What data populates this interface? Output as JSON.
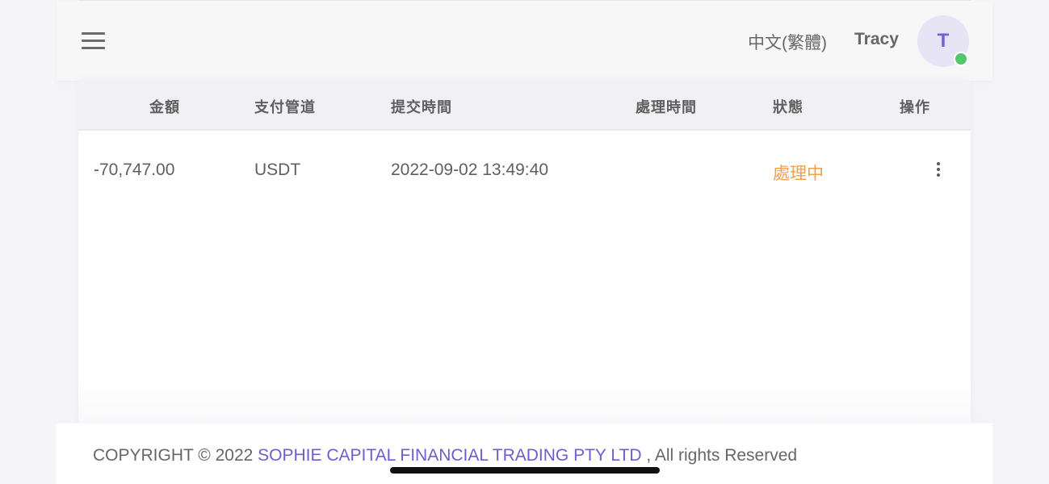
{
  "header": {
    "language": "中文(繁體)",
    "username": "Tracy",
    "avatar_initial": "T"
  },
  "table": {
    "columns": [
      "金額",
      "支付管道",
      "提交時間",
      "處理時間",
      "狀態",
      "操作"
    ],
    "rows": [
      {
        "amount": "-70,747.00",
        "channel": "USDT",
        "submitted": "2022-09-02 13:49:40",
        "processed": "",
        "status": "處理中"
      }
    ]
  },
  "footer": {
    "copyright": "COPYRIGHT © 2022",
    "company": "SOPHIE CAPITAL FINANCIAL TRADING PTY LTD",
    "rights": ", All rights Reserved"
  },
  "colors": {
    "accent": "#6a5fd0",
    "status_pending": "#f0a04b",
    "online": "#52c76b"
  }
}
